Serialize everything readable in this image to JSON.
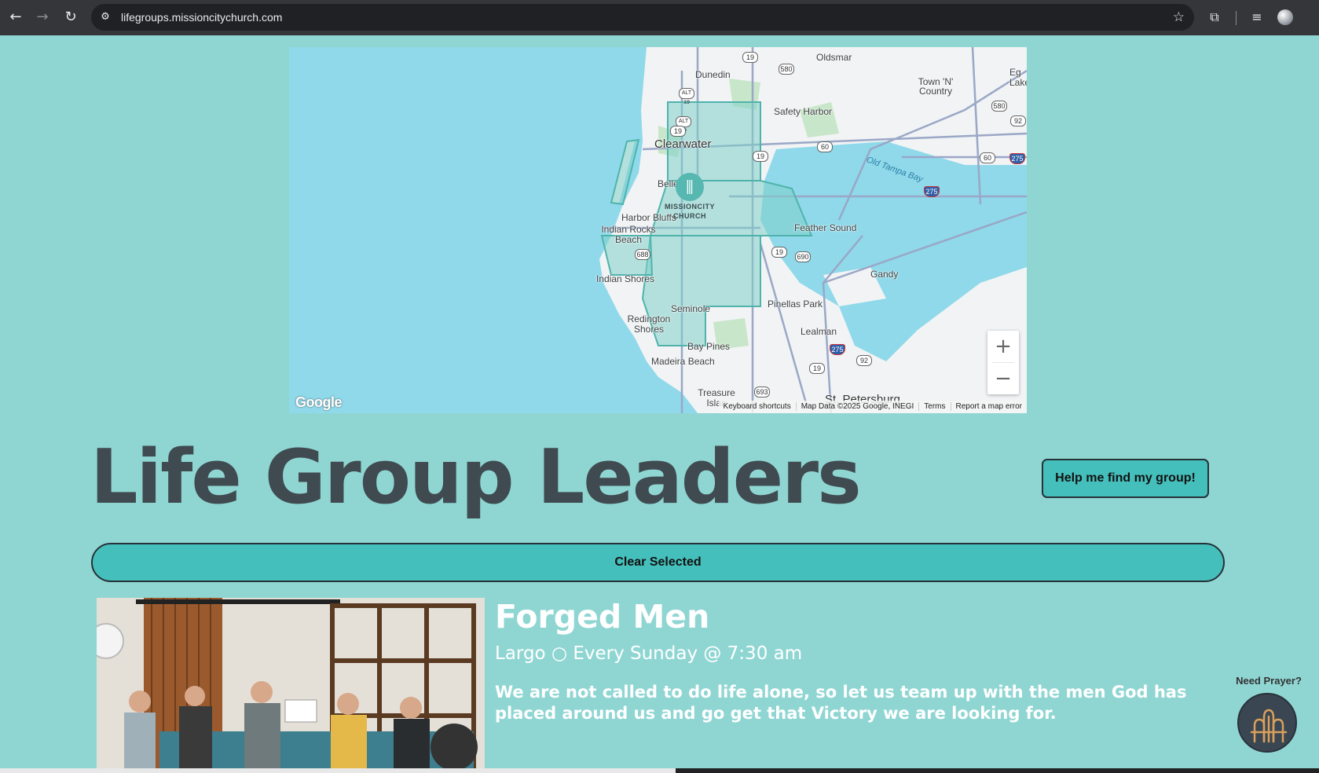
{
  "browser": {
    "url": "lifegroups.missioncitychurch.com",
    "icons": [
      "back-arrow-icon",
      "forward-arrow-icon",
      "reload-icon",
      "site-settings-icon",
      "bookmark-star-icon",
      "extensions-icon",
      "media-control-icon",
      "profile-avatar-icon"
    ]
  },
  "map": {
    "labels": {
      "oldsmar": "Oldsmar",
      "dunedin": "Dunedin",
      "town_n_country": "Town 'N' Country",
      "lake": "Eg Lake",
      "safety_harbor": "Safety Harbor",
      "clearwater": "Clearwater",
      "old_tampa_bay": "Old Tampa Bay",
      "belleair": "Bellea",
      "harbor_bluffs": "Harbor Bluffs",
      "indian_rocks_beach": "Indian Rocks Beach",
      "feather_sound": "Feather Sound",
      "gandy": "Gandy",
      "indian_shores": "Indian Shores",
      "seminole": "Seminole",
      "pinellas_park": "Pinellas Park",
      "redington_shores": "Redington Shores",
      "lealman": "Lealman",
      "bay_pines": "Bay Pines",
      "madeira_beach": "Madeira Beach",
      "treasure_island": "Treasure Islan",
      "st_petersburg": "St. Petersburg"
    },
    "route_badges": [
      "19",
      "580",
      "ALT 19",
      "ALT 19",
      "19",
      "580",
      "92",
      "60",
      "19",
      "60",
      "275",
      "275",
      "688",
      "19",
      "690",
      "275",
      "92",
      "19",
      "693"
    ],
    "church_marker": {
      "line1": "MISSIONCITY",
      "line2": "CHURCH"
    },
    "zoom_in_label": "+",
    "zoom_out_label": "−",
    "google_logo": "Google",
    "attribution": {
      "keyboard_shortcuts": "Keyboard shortcuts",
      "map_data": "Map Data ©2025 Google, INEGI",
      "terms": "Terms",
      "report": "Report a map error"
    }
  },
  "page": {
    "title": "Life Group Leaders",
    "help_button": "Help me find my group!",
    "clear_button": "Clear Selected"
  },
  "group": {
    "name": "Forged Men",
    "meta": "Largo ○ Every Sunday @ 7:30 am",
    "description": "We are not called to do life alone, so let us team up with the men God has placed around us and go get that Victory we are looking for."
  },
  "prayer": {
    "label": "Need Prayer?"
  },
  "colors": {
    "page_background": "#8fd6d3",
    "button_teal": "#45bfbb",
    "title_dark": "#404b51",
    "water": "#8fd9ea"
  }
}
